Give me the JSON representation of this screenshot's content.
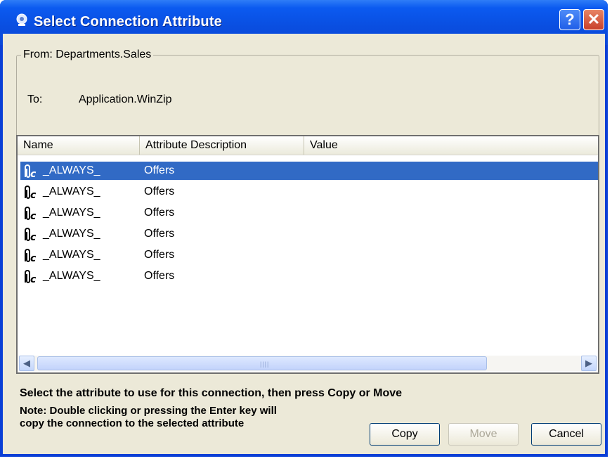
{
  "window": {
    "title": "Select Connection Attribute"
  },
  "titlebar": {
    "help_label": "?",
    "close_label": "✕"
  },
  "connection": {
    "from_label": "From: Departments.Sales",
    "to_label": "To:",
    "to_value": "Application.WinZip"
  },
  "columns": [
    "Name",
    "Attribute Description",
    "Value"
  ],
  "rows": [
    {
      "name": "_ALWAYS_",
      "description": "Offers",
      "value": "",
      "selected": true
    },
    {
      "name": "_ALWAYS_",
      "description": "Offers",
      "value": "",
      "selected": false
    },
    {
      "name": "_ALWAYS_",
      "description": "Offers",
      "value": "",
      "selected": false
    },
    {
      "name": "_ALWAYS_",
      "description": "Offers",
      "value": "",
      "selected": false
    },
    {
      "name": "_ALWAYS_",
      "description": "Offers",
      "value": "",
      "selected": false
    },
    {
      "name": "_ALWAYS_",
      "description": "Offers",
      "value": "",
      "selected": false
    }
  ],
  "row_icon": "paperclip-c-icon",
  "instruction": "Select the attribute to use for this connection, then press Copy or Move",
  "note_line1": "Note: Double clicking or pressing the Enter key will",
  "note_line2": "copy the connection to the selected attribute",
  "buttons": {
    "copy": "Copy",
    "move": "Move",
    "cancel": "Cancel"
  },
  "colors": {
    "selection": "#316ac5",
    "titlebar": "#0a4ee0",
    "dialog_bg": "#ece9d8"
  }
}
